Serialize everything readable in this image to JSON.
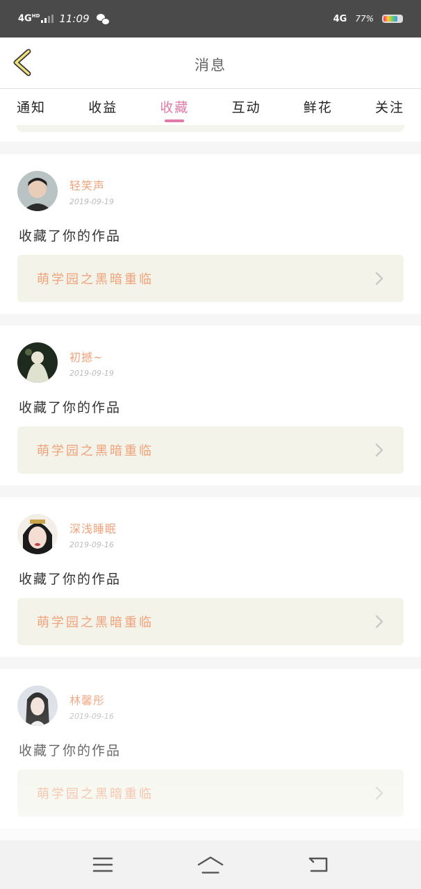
{
  "status_bar": {
    "network_left": "4G",
    "network_left_suffix": "HD",
    "time": "11:09",
    "network_right": "4G",
    "battery": "77%"
  },
  "nav": {
    "title": "消息",
    "back_icon": "chevron-left-icon"
  },
  "tabs": [
    {
      "label": "通知"
    },
    {
      "label": "收益"
    },
    {
      "label": "收藏"
    },
    {
      "label": "互动"
    },
    {
      "label": "鲜花"
    },
    {
      "label": "关注"
    }
  ],
  "active_tab": "收藏",
  "colors": {
    "accent": "#e07aa8",
    "username": "#f0a27a",
    "work_box": "#f3f3ea"
  },
  "items": [
    {
      "name": "轻笑声",
      "date": "2019-09-19",
      "action": "收藏了你的作品",
      "work": "萌学园之黑暗重临"
    },
    {
      "name": "初撼~",
      "date": "2019-09-19",
      "action": "收藏了你的作品",
      "work": "萌学园之黑暗重临"
    },
    {
      "name": "深浅睡眠",
      "date": "2019-09-16",
      "action": "收藏了你的作品",
      "work": "萌学园之黑暗重临"
    },
    {
      "name": "林馨彤",
      "date": "2019-09-16",
      "action": "收藏了你的作品",
      "work": "萌学园之黑暗重临"
    }
  ],
  "bottom_nav": [
    "menu-icon",
    "home-icon",
    "back-icon"
  ]
}
